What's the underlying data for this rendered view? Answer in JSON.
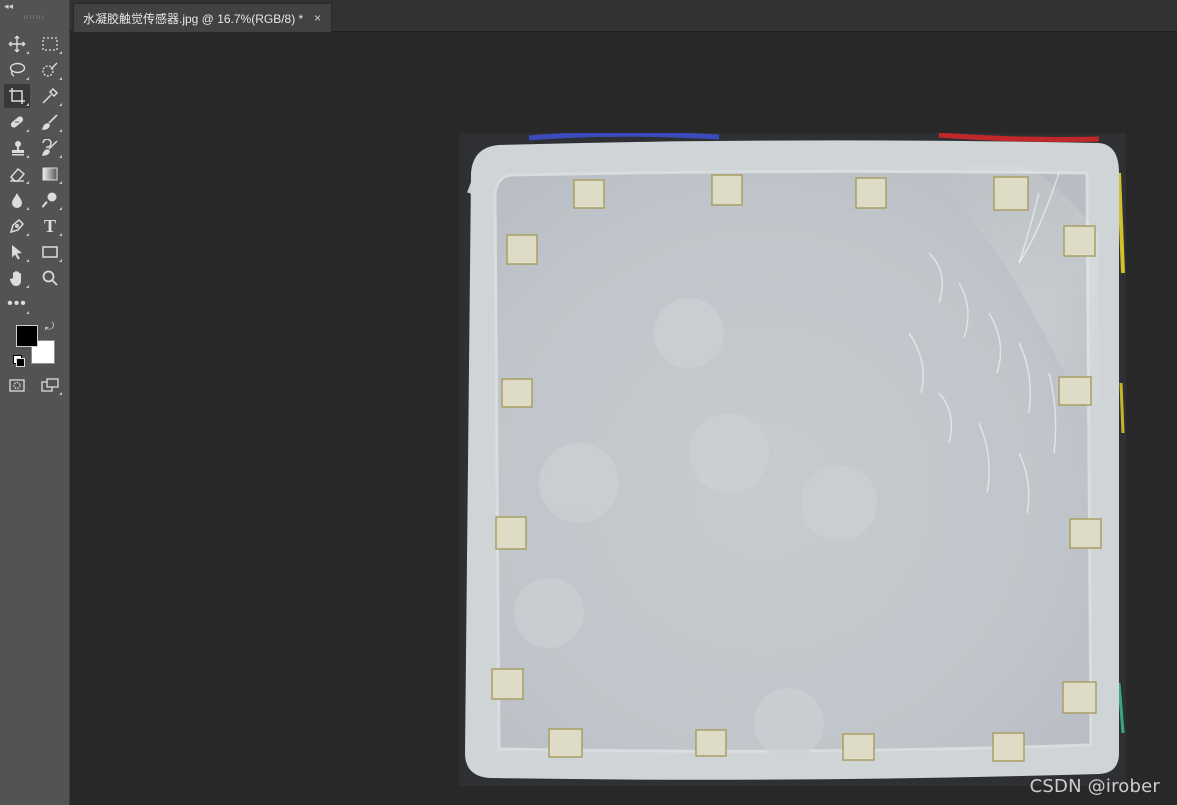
{
  "document": {
    "tab_title": "水凝胶触觉传感器.jpg @ 16.7%(RGB/8) *",
    "close_glyph": "×"
  },
  "toolbar": {
    "collapse_glyph": "◂◂",
    "tools": [
      {
        "name": "move-tool-icon"
      },
      {
        "name": "marquee-tool-icon"
      },
      {
        "name": "lasso-tool-icon"
      },
      {
        "name": "quick-selection-tool-icon"
      },
      {
        "name": "crop-tool-icon"
      },
      {
        "name": "eyedropper-tool-icon"
      },
      {
        "name": "healing-brush-tool-icon"
      },
      {
        "name": "brush-tool-icon"
      },
      {
        "name": "clone-stamp-tool-icon"
      },
      {
        "name": "history-brush-tool-icon"
      },
      {
        "name": "eraser-tool-icon"
      },
      {
        "name": "gradient-tool-icon"
      },
      {
        "name": "blur-tool-icon"
      },
      {
        "name": "dodge-tool-icon"
      },
      {
        "name": "pen-tool-icon"
      },
      {
        "name": "type-tool-icon",
        "text": "T"
      },
      {
        "name": "path-selection-tool-icon"
      },
      {
        "name": "rectangle-tool-icon"
      },
      {
        "name": "hand-tool-icon"
      },
      {
        "name": "zoom-tool-icon"
      },
      {
        "name": "more-tools-icon",
        "text": "•••"
      },
      {
        "name": "quick-mask-icon"
      },
      {
        "name": "screen-mode-icon"
      }
    ],
    "foreground_color": "#000000",
    "background_color": "#ffffff",
    "swap_glyph": "⤾"
  },
  "canvas": {
    "watermark": "CSDN @irober"
  }
}
